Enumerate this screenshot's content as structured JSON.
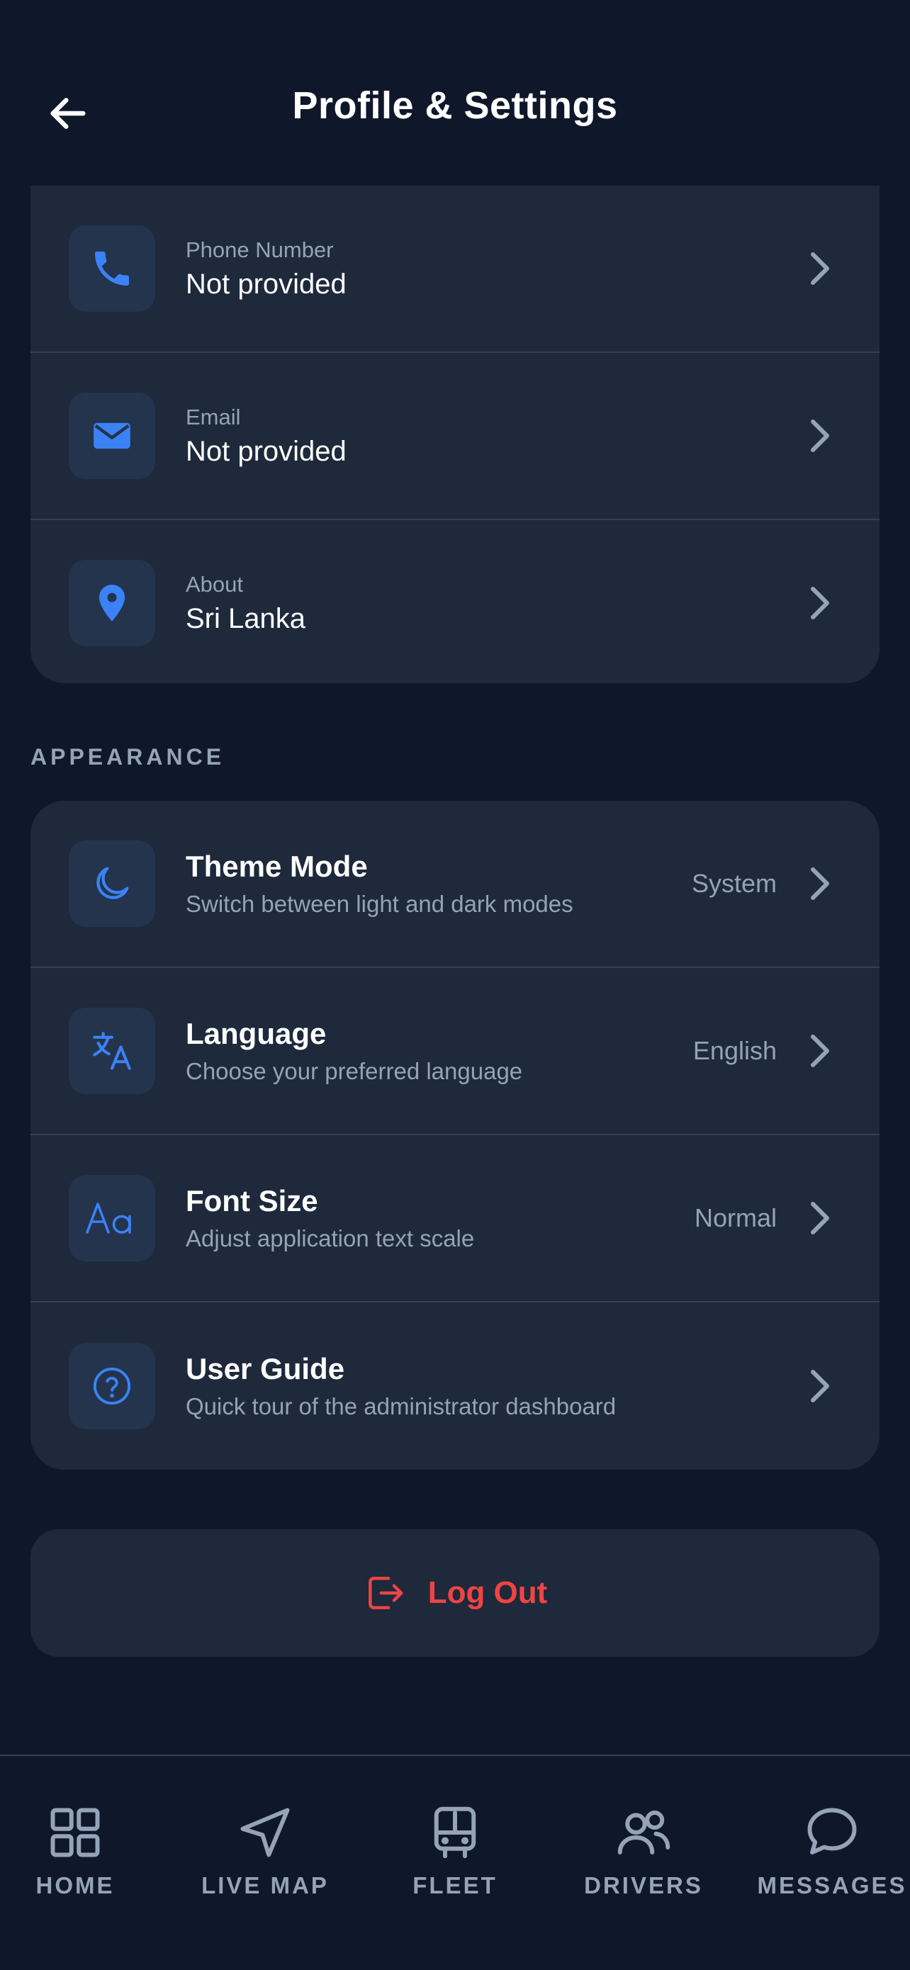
{
  "header": {
    "title": "Profile & Settings"
  },
  "contact": [
    {
      "label": "Phone Number",
      "value": "Not provided",
      "icon": "phone-icon"
    },
    {
      "label": "Email",
      "value": "Not provided",
      "icon": "mail-icon"
    },
    {
      "label": "About",
      "value": "Sri Lanka",
      "icon": "location-pin-icon"
    }
  ],
  "appearance": {
    "section_label": "APPEARANCE",
    "items": [
      {
        "title": "Theme Mode",
        "subtitle": "Switch between light and dark modes",
        "value": "System",
        "icon": "moon-icon"
      },
      {
        "title": "Language",
        "subtitle": "Choose your preferred language",
        "value": "English",
        "icon": "translate-icon"
      },
      {
        "title": "Font Size",
        "subtitle": "Adjust application text scale",
        "value": "Normal",
        "icon": "font-size-icon"
      },
      {
        "title": "User Guide",
        "subtitle": "Quick tour of the administrator dashboard",
        "value": "",
        "icon": "help-circle-icon"
      }
    ]
  },
  "logout": {
    "label": "Log Out"
  },
  "tabs": [
    {
      "label": "HOME",
      "icon": "grid-icon"
    },
    {
      "label": "LIVE MAP",
      "icon": "navigation-icon"
    },
    {
      "label": "FLEET",
      "icon": "bus-icon"
    },
    {
      "label": "DRIVERS",
      "icon": "users-icon"
    },
    {
      "label": "MESSAGES",
      "icon": "chat-bubble-icon"
    }
  ],
  "colors": {
    "background": "#0f172a",
    "card": "#1e293b",
    "accent": "#3b82f6",
    "danger": "#ef4444",
    "muted": "#94a3b8"
  }
}
